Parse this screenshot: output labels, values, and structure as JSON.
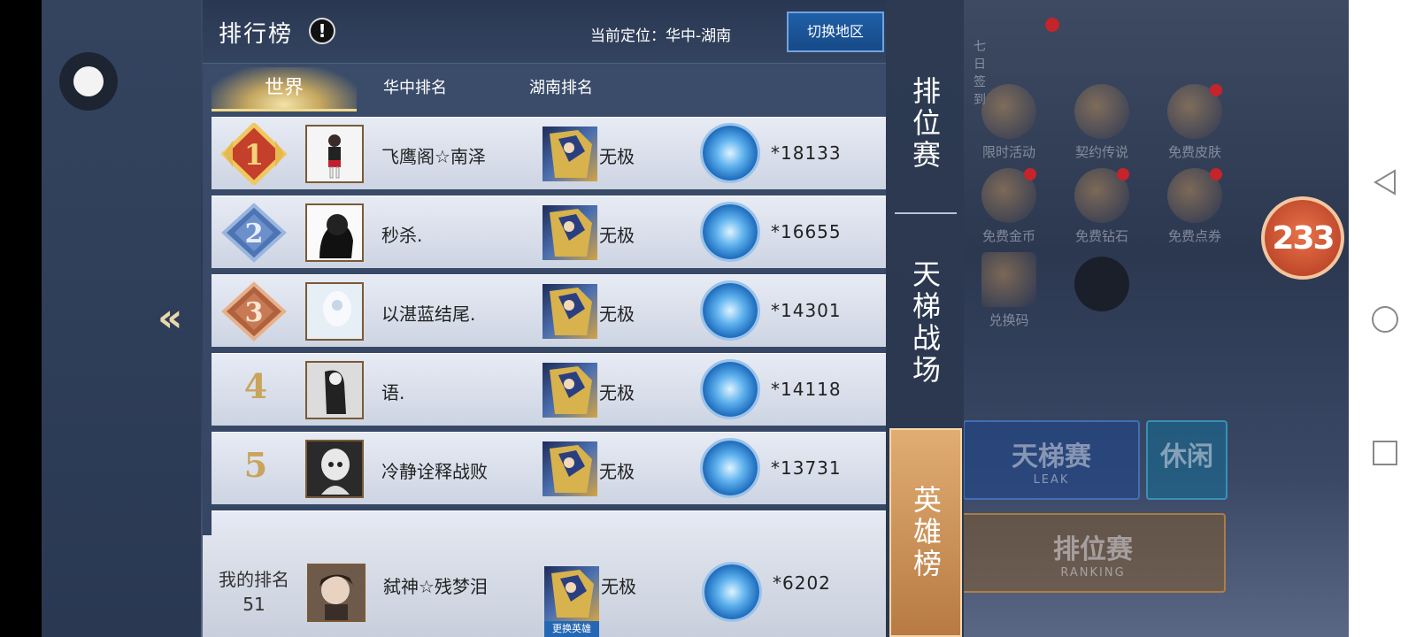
{
  "panel": {
    "title": "排行榜",
    "info_icon": "!",
    "location_label": "当前定位：华中-湖南",
    "switch_region_label": "切换地区"
  },
  "tabs": [
    {
      "label": "世界",
      "active": true
    },
    {
      "label": "华中排名",
      "active": false
    },
    {
      "label": "湖南排名",
      "active": false
    }
  ],
  "rows": [
    {
      "rank": "1",
      "name": "飞鹰阁☆南泽",
      "hero": "无极",
      "score": "*18133",
      "medal": "gold"
    },
    {
      "rank": "2",
      "name": "秒杀.",
      "hero": "无极",
      "score": "*16655",
      "medal": "blue"
    },
    {
      "rank": "3",
      "name": "以湛蓝结尾.",
      "hero": "无极",
      "score": "*14301",
      "medal": "bronze"
    },
    {
      "rank": "4",
      "name": "语.",
      "hero": "无极",
      "score": "*14118",
      "medal": "none"
    },
    {
      "rank": "5",
      "name": "冷静诠释战败",
      "hero": "无极",
      "score": "*13731",
      "medal": "none"
    }
  ],
  "my_rank": {
    "label": "我的排名",
    "rank": "51",
    "name": "弑神☆残梦泪",
    "hero": "无极",
    "score": "*6202",
    "change_hero_label": "更换英雄"
  },
  "side_tabs": {
    "ranked": "排位赛",
    "ladder": "天梯战场",
    "hero": "英雄榜"
  },
  "background_menu": {
    "sign_in": "七日签到",
    "limited_event": "限时活动",
    "contract_legend": "契约传说",
    "free_skin": "免费皮肤",
    "free_gold": "免费金币",
    "free_diamond": "免费钻石",
    "free_points": "免费点券",
    "redeem_code": "兑换码",
    "notification_count": "233",
    "mode_ladder": "天梯赛",
    "mode_ladder_sub": "LEAK",
    "mode_leisure": "休闲",
    "mode_ranked": "排位赛",
    "mode_ranked_sub": "RANKING"
  }
}
